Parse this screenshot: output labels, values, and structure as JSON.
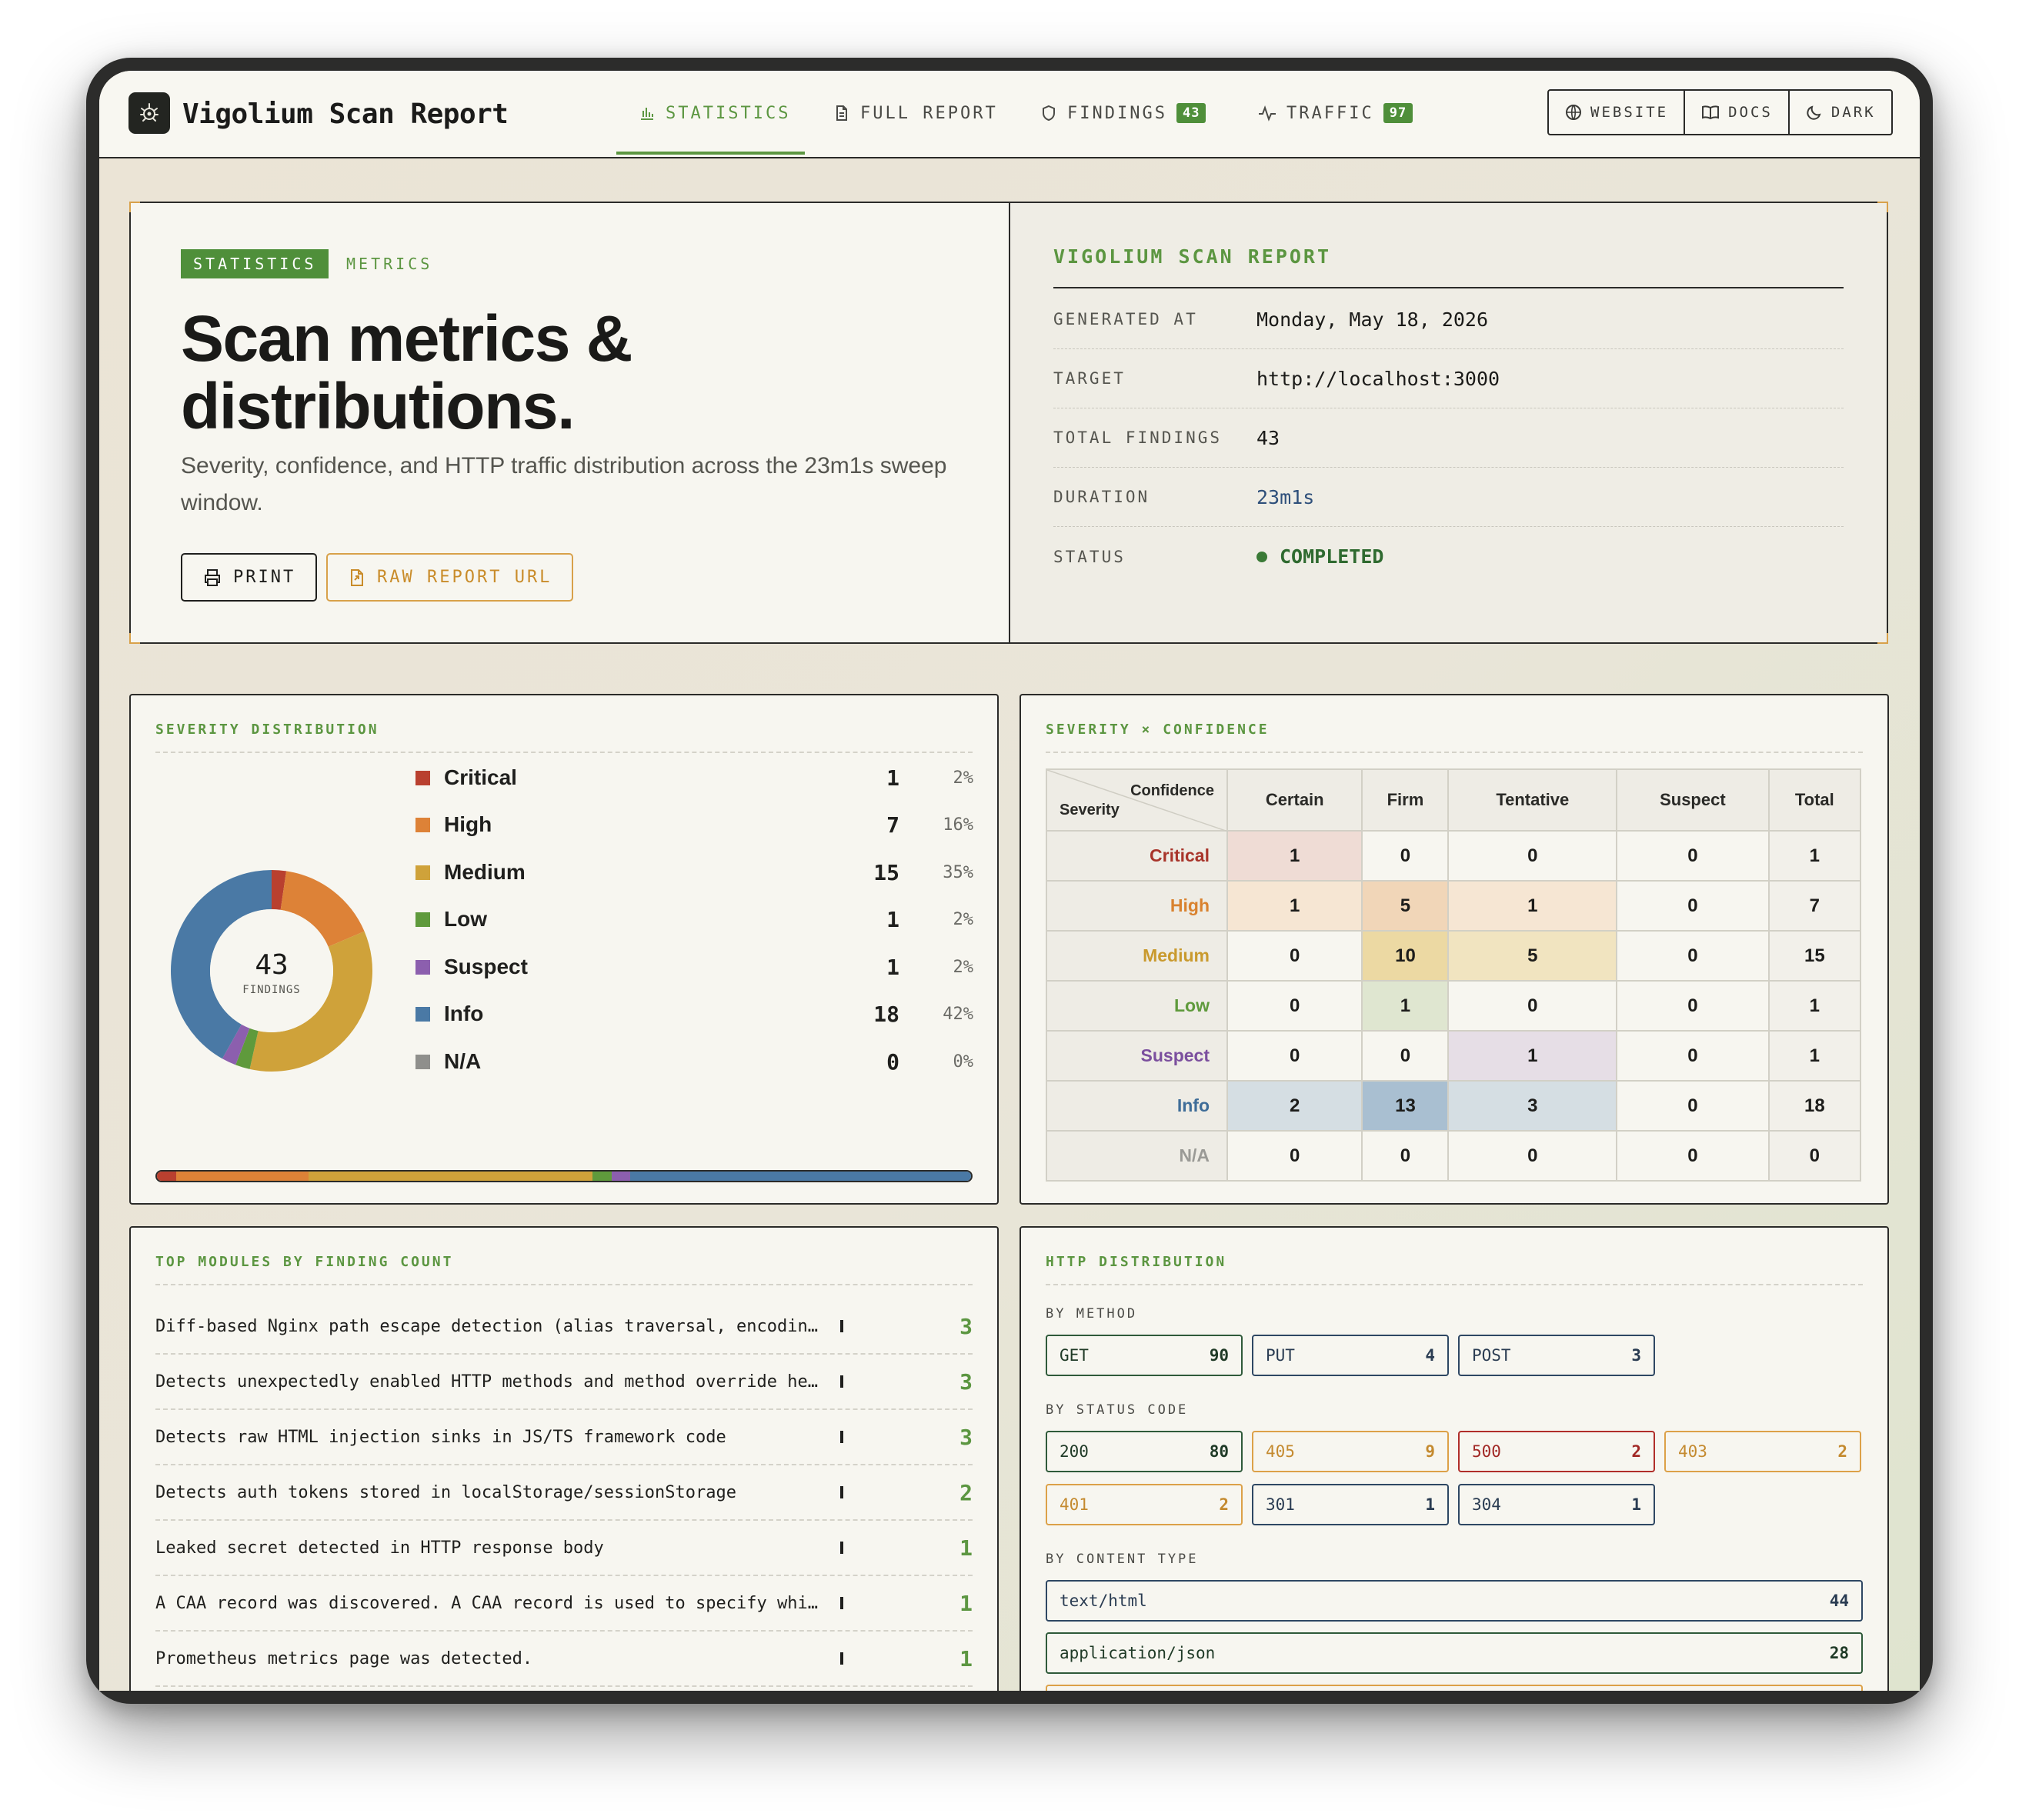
{
  "app": {
    "title": "Vigolium Scan Report"
  },
  "nav": {
    "tabs": [
      {
        "label": "STATISTICS",
        "badge": ""
      },
      {
        "label": "FULL REPORT",
        "badge": ""
      },
      {
        "label": "FINDINGS",
        "badge": "43"
      },
      {
        "label": "TRAFFIC",
        "badge": "97"
      }
    ],
    "buttons": {
      "website": "WEBSITE",
      "docs": "DOCS",
      "dark": "DARK"
    }
  },
  "hero": {
    "pill": "STATISTICS",
    "pill2": "METRICS",
    "title": "Scan metrics & distributions.",
    "subtitle": "Severity, confidence, and HTTP traffic distribution across the 23m1s sweep window.",
    "print_label": "PRINT",
    "raw_label": "RAW REPORT URL"
  },
  "meta": {
    "title": "VIGOLIUM SCAN REPORT",
    "rows": [
      {
        "key": "GENERATED AT",
        "value": "Monday, May 18, 2026"
      },
      {
        "key": "TARGET",
        "value": "http://localhost:3000"
      },
      {
        "key": "TOTAL FINDINGS",
        "value": "43"
      },
      {
        "key": "DURATION",
        "value": "23m1s"
      },
      {
        "key": "STATUS",
        "value": "COMPLETED"
      }
    ]
  },
  "severity": {
    "title": "SEVERITY DISTRIBUTION",
    "total": "43",
    "total_label": "FINDINGS",
    "items": [
      {
        "name": "Critical",
        "count": "1",
        "pct": "2%",
        "value": 1,
        "color": "#b9402f"
      },
      {
        "name": "High",
        "count": "7",
        "pct": "16%",
        "value": 7,
        "color": "#dd8237"
      },
      {
        "name": "Medium",
        "count": "15",
        "pct": "35%",
        "value": 15,
        "color": "#cfa23a"
      },
      {
        "name": "Low",
        "count": "1",
        "pct": "2%",
        "value": 1,
        "color": "#5f9a3c"
      },
      {
        "name": "Suspect",
        "count": "1",
        "pct": "2%",
        "value": 1,
        "color": "#8c5fae"
      },
      {
        "name": "Info",
        "count": "18",
        "pct": "42%",
        "value": 18,
        "color": "#4a79a5"
      },
      {
        "name": "N/A",
        "count": "0",
        "pct": "0%",
        "value": 0,
        "color": "#8f8f8c"
      }
    ]
  },
  "matrix": {
    "title": "SEVERITY × CONFIDENCE",
    "corner_top": "Confidence",
    "corner_bottom": "Severity",
    "columns": [
      "Certain",
      "Firm",
      "Tentative",
      "Suspect",
      "Total"
    ],
    "rows": [
      {
        "label": "Critical",
        "color": "#a8342a",
        "cells": [
          "1",
          "0",
          "0",
          "0",
          "1"
        ],
        "bg": [
          "#efdcd5",
          "",
          "",
          "",
          ""
        ]
      },
      {
        "label": "High",
        "color": "#d9822f",
        "cells": [
          "1",
          "5",
          "1",
          "0",
          "7"
        ],
        "bg": [
          "#f6e6d3",
          "#f1d6b8",
          "#f6e6d3",
          "",
          ""
        ]
      },
      {
        "label": "Medium",
        "color": "#c99a2e",
        "cells": [
          "0",
          "10",
          "5",
          "0",
          "15"
        ],
        "bg": [
          "",
          "#ecd9a3",
          "#f1e4c0",
          "",
          ""
        ]
      },
      {
        "label": "Low",
        "color": "#5f9a3c",
        "cells": [
          "0",
          "1",
          "0",
          "0",
          "1"
        ],
        "bg": [
          "",
          "#dfe6d0",
          "",
          "",
          ""
        ]
      },
      {
        "label": "Suspect",
        "color": "#7b4f9e",
        "cells": [
          "0",
          "0",
          "1",
          "0",
          "1"
        ],
        "bg": [
          "",
          "",
          "#e6dee6",
          "",
          ""
        ]
      },
      {
        "label": "Info",
        "color": "#3f6d98",
        "cells": [
          "2",
          "13",
          "3",
          "0",
          "18"
        ],
        "bg": [
          "#d5dee3",
          "#a9bfd1",
          "#d5dee3",
          "",
          ""
        ]
      },
      {
        "label": "N/A",
        "color": "#9a9a96",
        "cells": [
          "0",
          "0",
          "0",
          "0",
          "0"
        ],
        "bg": [
          "",
          "",
          "",
          "",
          ""
        ]
      }
    ]
  },
  "modules": {
    "title": "TOP MODULES BY FINDING COUNT",
    "items": [
      {
        "name": "Diff-based Nginx path escape detection (alias traversal, encodin…",
        "count": "3"
      },
      {
        "name": "Detects unexpectedly enabled HTTP methods and method override he…",
        "count": "3"
      },
      {
        "name": "Detects raw HTML injection sinks in JS/TS framework code",
        "count": "3"
      },
      {
        "name": "Detects auth tokens stored in localStorage/sessionStorage",
        "count": "2"
      },
      {
        "name": "Leaked secret detected in HTTP response body",
        "count": "1"
      },
      {
        "name": "A CAA record was discovered. A CAA record is used to specify whi…",
        "count": "1"
      },
      {
        "name": "Prometheus metrics page was detected.",
        "count": "1"
      }
    ]
  },
  "http": {
    "title": "HTTP DISTRIBUTION",
    "by_method_label": "BY METHOD",
    "methods": [
      {
        "name": "GET",
        "count": "90"
      },
      {
        "name": "PUT",
        "count": "4"
      },
      {
        "name": "POST",
        "count": "3"
      }
    ],
    "by_status_label": "BY STATUS CODE",
    "statuses": [
      {
        "name": "200",
        "count": "80"
      },
      {
        "name": "405",
        "count": "9"
      },
      {
        "name": "500",
        "count": "2"
      },
      {
        "name": "403",
        "count": "2"
      },
      {
        "name": "401",
        "count": "2"
      },
      {
        "name": "301",
        "count": "1"
      },
      {
        "name": "304",
        "count": "1"
      }
    ],
    "by_content_label": "BY CONTENT TYPE",
    "content_types": [
      {
        "name": "text/html",
        "count": "44"
      },
      {
        "name": "application/json",
        "count": "28"
      }
    ]
  }
}
